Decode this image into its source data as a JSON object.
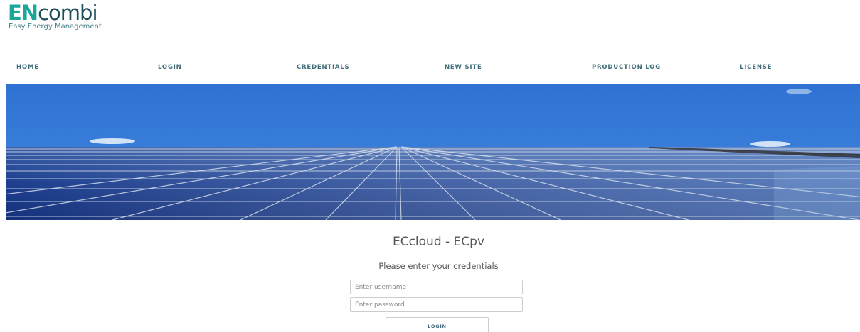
{
  "brand": {
    "logo_prefix": "EN",
    "logo_suffix": "combi",
    "tagline": "Easy Energy Management",
    "colors": {
      "prefix": "#1aa79a",
      "suffix": "#1c4f5c",
      "nav": "#3f6b78"
    }
  },
  "nav": {
    "items": [
      {
        "label": "HOME"
      },
      {
        "label": "LOGIN"
      },
      {
        "label": "CREDENTIALS"
      },
      {
        "label": "NEW SITE"
      },
      {
        "label": "PRODUCTION LOG"
      },
      {
        "label": "LICENSE"
      }
    ]
  },
  "banner": {
    "subject": "solar-panels-photo"
  },
  "login": {
    "title": "ECcloud - ECpv",
    "subtitle": "Please enter your credentials",
    "username_placeholder": "Enter username",
    "password_placeholder": "Enter password",
    "button_label": "LOGIN"
  }
}
